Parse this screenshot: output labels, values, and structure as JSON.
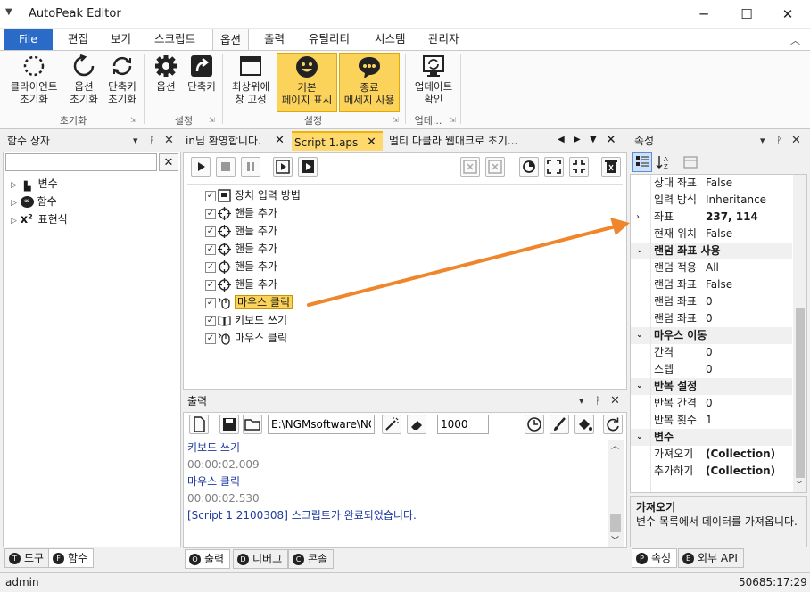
{
  "app": {
    "title": "AutoPeak Editor",
    "status_user": "admin",
    "status_time": "50685:17:29"
  },
  "colors": {
    "accent": "#2b6bc8",
    "highlight": "#fcd35a",
    "arrow": "#f0862c"
  },
  "ribbon_tabs": [
    "File",
    "편집",
    "보기",
    "스크립트",
    "옵션",
    "출력",
    "유틸리티",
    "시스템",
    "관리자"
  ],
  "ribbon": {
    "g1": {
      "b1": "클라이언트",
      "b1b": "초기화",
      "b2": "옵션",
      "b2b": "초기화",
      "b3": "단축키",
      "b3b": "초기화",
      "label": "초기화"
    },
    "g2": {
      "b1": "옵션",
      "b2": "단축키",
      "label": "설정"
    },
    "g3": {
      "b1": "최상위에",
      "b1b": "창 고정",
      "b2": "기본",
      "b2b": "페이지 표시",
      "b3": "종료",
      "b3b": "메세지 사용",
      "label": "설정"
    },
    "g4": {
      "b1": "업데이트",
      "b1b": "확인",
      "label": "업데..."
    }
  },
  "left_panel": {
    "title": "함수 상자",
    "search_value": "",
    "items": [
      "변수",
      "함수",
      "표현식"
    ],
    "tab1": "도구",
    "tab2": "함수",
    "tab1_key": "T",
    "tab2_key": "F"
  },
  "editor": {
    "tabs": [
      "in님 환영합니다.",
      "Script 1.aps",
      "멀티 다클라 웹매크로 초기..."
    ],
    "lines": [
      "장치 입력 방법",
      "핸들 추가",
      "핸들 추가",
      "핸들 추가",
      "핸들 추가",
      "핸들 추가",
      "마우스 클릭",
      "키보드 쓰기",
      "마우스 클릭"
    ]
  },
  "output": {
    "title": "출력",
    "path": "E:\\NGMsoftware\\NG",
    "count": "1000",
    "lines": [
      {
        "text": "키보드 쓰기",
        "kind": "blue"
      },
      {
        "text": "00:00:02.009",
        "kind": "gray"
      },
      {
        "text": "마우스 클릭",
        "kind": "blue"
      },
      {
        "text": "00:00:02.530",
        "kind": "gray"
      },
      {
        "text": "[Script 1 2100308] 스크립트가 완료되었습니다.",
        "kind": "blue"
      }
    ],
    "tabs": [
      "출력",
      "디버그",
      "콘솔"
    ],
    "tab_keys": [
      "O",
      "D",
      "C"
    ]
  },
  "props": {
    "title": "속성",
    "rows": [
      {
        "k": "상대 좌표",
        "v": "False",
        "cat": false
      },
      {
        "k": "입력 방식",
        "v": "Inheritance",
        "cat": false
      },
      {
        "k": "좌표",
        "v": "237, 114",
        "cat": false,
        "bold": true,
        "arrow": true
      },
      {
        "k": "현재 위치",
        "v": "False",
        "cat": false
      },
      {
        "k": "랜덤 좌표 사용",
        "v": "",
        "cat": true
      },
      {
        "k": "랜덤 적용",
        "v": "All",
        "cat": false
      },
      {
        "k": "랜덤 좌표",
        "v": "False",
        "cat": false
      },
      {
        "k": "랜덤 좌표",
        "v": "0",
        "cat": false
      },
      {
        "k": "랜덤 좌표",
        "v": "0",
        "cat": false
      },
      {
        "k": "마우스 이동",
        "v": "",
        "cat": true
      },
      {
        "k": "간격",
        "v": "0",
        "cat": false
      },
      {
        "k": "스텝",
        "v": "0",
        "cat": false
      },
      {
        "k": "반복 설정",
        "v": "",
        "cat": true
      },
      {
        "k": "반복 간격",
        "v": "0",
        "cat": false
      },
      {
        "k": "반복 횟수",
        "v": "1",
        "cat": false
      },
      {
        "k": "변수",
        "v": "",
        "cat": true
      },
      {
        "k": "가져오기",
        "v": "(Collection)",
        "cat": false,
        "bold": true
      },
      {
        "k": "추가하기",
        "v": "(Collection)",
        "cat": false,
        "bold": true
      }
    ],
    "desc_title": "가져오기",
    "desc_text": "변수 목록에서 데이터를 가져옵니다.",
    "tab1": "속성",
    "tab2": "외부 API",
    "tab1_key": "P",
    "tab2_key": "E"
  }
}
